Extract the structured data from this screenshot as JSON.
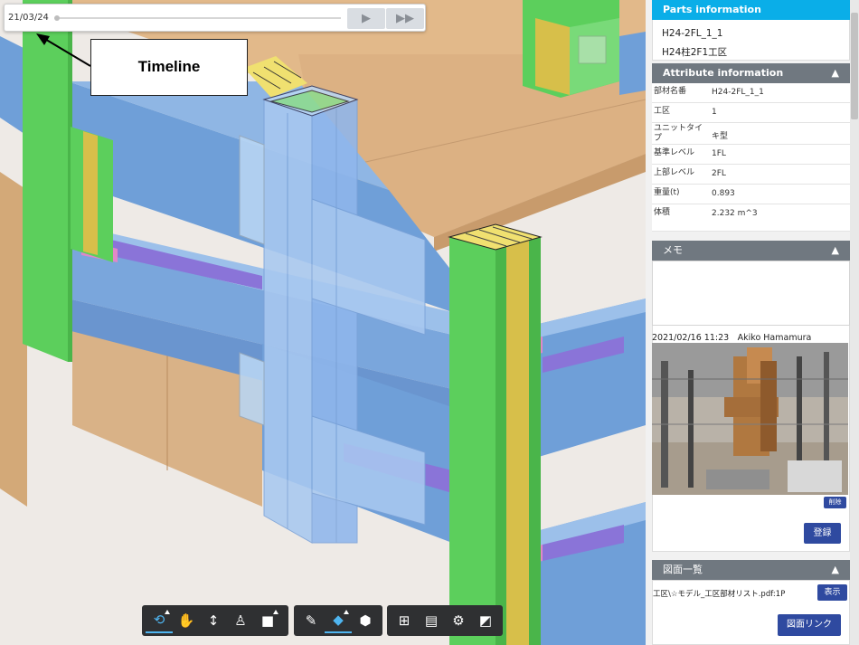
{
  "timeline": {
    "date": "21/03/24",
    "play_icon": "play-icon",
    "fast_forward_icon": "fast-forward-icon"
  },
  "callout": {
    "label": "Timeline"
  },
  "panel": {
    "parts_info": {
      "title": "Parts information",
      "lines": [
        "H24-2FL_1_1",
        "H24柱2F1工区"
      ]
    },
    "attribute_info": {
      "title": "Attribute information",
      "rows": [
        {
          "key": "部材名番",
          "value": "H24-2FL_1_1"
        },
        {
          "key": "工区",
          "value": "1"
        },
        {
          "key": "ユニットタイプ",
          "value": "キ型"
        },
        {
          "key": "基準レベル",
          "value": "1FL"
        },
        {
          "key": "上部レベル",
          "value": "2FL"
        },
        {
          "key": "重量(t)",
          "value": "0.893"
        },
        {
          "key": "体積",
          "value": "2.232 m^3"
        }
      ]
    },
    "memo": {
      "title": "メモ",
      "author_line": "2021/02/16 11:23　Akiko Hamamura",
      "delete_label": "削除",
      "register_label": "登録"
    },
    "drawings": {
      "title": "図面一覧",
      "file": "工区\\☆モデル_工区部材リスト.pdf:1P",
      "show_label": "表示",
      "link_label": "図面リンク"
    }
  },
  "toolbar": {
    "groups": [
      [
        "orbit-icon",
        "pan-hand-icon",
        "zoom-updown-icon",
        "walk-person-icon",
        "camera-icon"
      ],
      [
        "measure-pencil-icon",
        "section-plane-icon",
        "cube-view-icon"
      ],
      [
        "model-tree-icon",
        "properties-icon",
        "settings-gear-icon",
        "fullscreen-icon"
      ]
    ]
  },
  "colors": {
    "accent": "#0aaee8",
    "panel_header": "#707880",
    "button": "#2f4aa0",
    "beam_blue": "#6f9fd8",
    "column_green": "#5ccf5c",
    "slab_tan": "#e2b98a",
    "selected_part": "#a8c8f0"
  }
}
